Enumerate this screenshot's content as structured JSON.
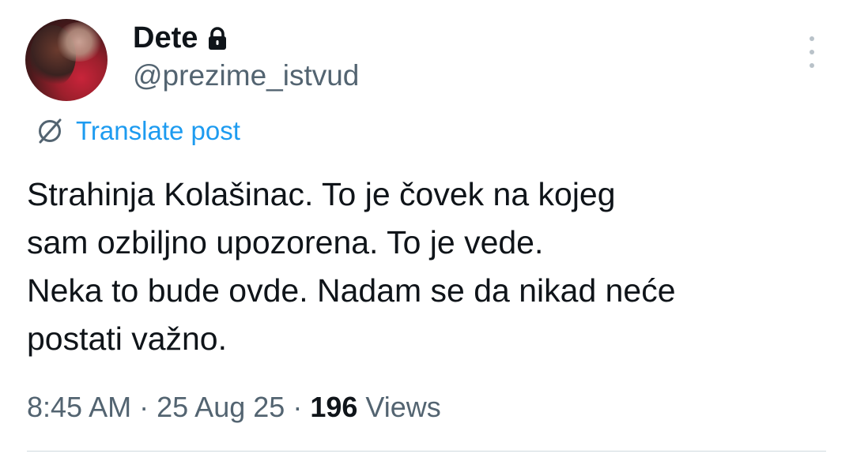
{
  "author": {
    "display_name": "Dete",
    "handle": "@prezime_istvud",
    "protected_icon": "lock-icon",
    "avatar_icon": "avatar-photo"
  },
  "menu": {
    "more_icon": "more-vertical-icon"
  },
  "translate": {
    "icon": "translate-globe-icon",
    "label": "Translate post"
  },
  "post": {
    "lines": [
      "Strahinja Kolašinac. To je čovek na kojeg",
      "sam ozbiljno upozorena. To je vede.",
      "Neka to bude ovde. Nadam se da nikad neće",
      "postati važno."
    ]
  },
  "meta": {
    "time": "8:45 AM",
    "separator": "·",
    "date": "25 Aug 25",
    "views_count": "196",
    "views_label": "Views"
  },
  "colors": {
    "link": "#1d9bf0",
    "secondary_text": "#536471",
    "primary_text": "#0f1419",
    "divider": "#cfd9de"
  }
}
